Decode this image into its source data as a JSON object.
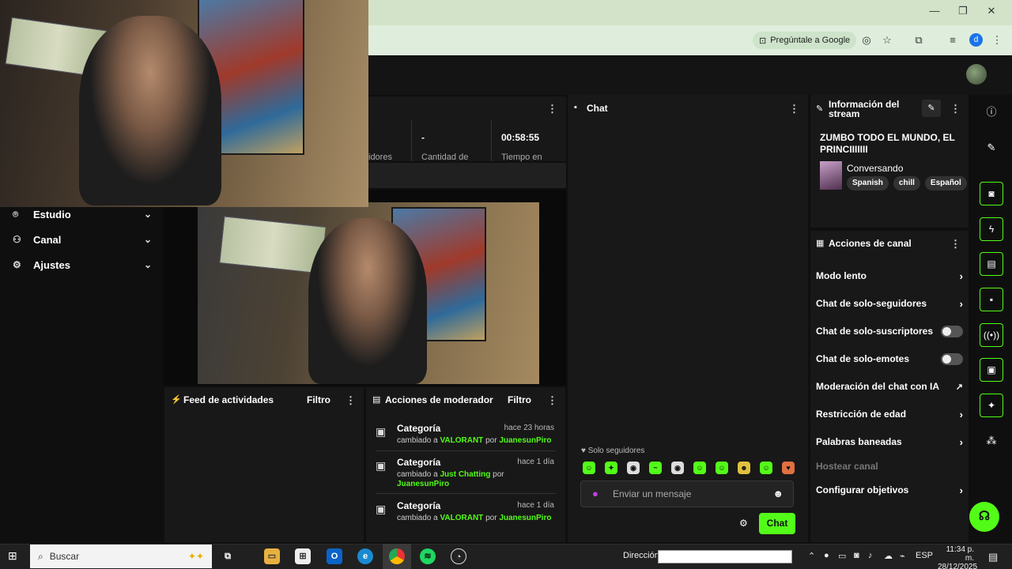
{
  "browser": {
    "ask_google": "Pregúntale a Google",
    "profile_initial": "d",
    "window_controls": {
      "minimize": "—",
      "maximize": "❐",
      "close": "✕"
    }
  },
  "nav": [
    {
      "label": "Estudio",
      "icon": "studio-icon"
    },
    {
      "label": "Canal",
      "icon": "channel-icon"
    },
    {
      "label": "Ajustes",
      "icon": "settings-gear-icon"
    }
  ],
  "stats": {
    "followers_label": "idores",
    "amount_value": "-",
    "amount_label": "Cantidad de",
    "time_value": "00:58:55",
    "time_label": "Tiempo en"
  },
  "chat": {
    "title": "Chat",
    "followers_only": "Solo seguidores",
    "input_placeholder": "Enviar un mensaje",
    "send_button": "Chat"
  },
  "stream_info": {
    "title": "Información del stream",
    "stream_title": "ZUMBO TODO EL MUNDO, EL PRINCIIIIIII",
    "category": "Conversando",
    "tags": [
      "Spanish",
      "chill",
      "Español"
    ]
  },
  "channel_actions": {
    "title": "Acciones de canal",
    "items": [
      {
        "label": "Modo lento",
        "control": "chevron"
      },
      {
        "label": "Chat de solo-seguidores",
        "control": "chevron"
      },
      {
        "label": "Chat de solo-suscriptores",
        "control": "toggle"
      },
      {
        "label": "Chat de solo-emotes",
        "control": "toggle"
      },
      {
        "label": "Moderación del chat con IA",
        "control": "external"
      },
      {
        "label": "Restricción de edad",
        "control": "chevron"
      },
      {
        "label": "Palabras baneadas",
        "control": "chevron"
      },
      {
        "label": "Hostear canal",
        "control": "none"
      },
      {
        "label": "Configurar objetivos",
        "control": "chevron"
      }
    ]
  },
  "activity_feed": {
    "title": "Feed de actividades",
    "filter": "Filtro"
  },
  "mod_actions": {
    "title": "Acciones de moderador",
    "filter": "Filtro",
    "items": [
      {
        "heading": "Categoría",
        "time": "hace 23 horas",
        "prefix": "cambiado a",
        "target": "VALORANT",
        "by": "por",
        "user": "JuanesunPiro"
      },
      {
        "heading": "Categoría",
        "time": "hace 1 día",
        "prefix": "cambiado a",
        "target": "Just Chatting",
        "by": "por",
        "user": "JuanesunPiro"
      },
      {
        "heading": "Categoría",
        "time": "hace 1 día",
        "prefix": "cambiado a",
        "target": "VALORANT",
        "by": "por",
        "user": "JuanesunPiro"
      }
    ]
  },
  "taskbar": {
    "search": "Buscar",
    "address_label": "Dirección",
    "language": "ESP",
    "time": "11:34 p. m.",
    "date": "28/12/2025"
  },
  "colors": {
    "accent": "#53fc18",
    "panel": "#181818",
    "background": "#0f0f0f"
  }
}
